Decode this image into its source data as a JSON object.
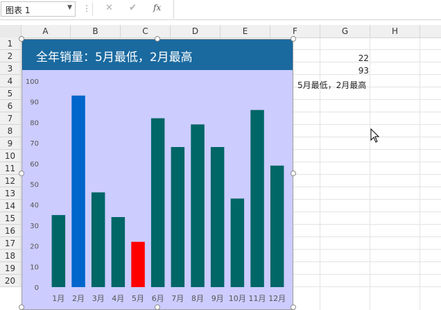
{
  "namebox": {
    "value": "图表 1"
  },
  "formula_bar": {
    "fx_label": "fx",
    "value": ""
  },
  "columns": [
    "A",
    "B",
    "C",
    "D",
    "E",
    "F",
    "G",
    "H"
  ],
  "rows": [
    "1",
    "2",
    "3",
    "4",
    "5",
    "6",
    "7",
    "8",
    "9",
    "10",
    "11",
    "12",
    "13",
    "14",
    "15",
    "16",
    "17",
    "18",
    "19",
    "20"
  ],
  "cells": {
    "G2": "22",
    "G3": "93",
    "F4": "：5月最低，2月最高"
  },
  "chart": {
    "title": "全年销量：5月最低，2月最高",
    "colors": {
      "title_bg": "#1a6aa0",
      "plot_bg": "#ccccff",
      "bar_default": "#006666",
      "bar_max": "#0066cc",
      "bar_min": "#ff0000"
    }
  },
  "chart_data": {
    "type": "bar",
    "title": "全年销量：5月最低，2月最高",
    "categories": [
      "1月",
      "2月",
      "3月",
      "4月",
      "5月",
      "6月",
      "7月",
      "8月",
      "9月",
      "10月",
      "11月",
      "12月"
    ],
    "values": [
      35,
      93,
      46,
      34,
      22,
      82,
      68,
      79,
      68,
      43,
      86,
      59
    ],
    "ylim": [
      0,
      100
    ],
    "yticks": [
      0,
      10,
      20,
      30,
      40,
      50,
      60,
      70,
      80,
      90,
      100
    ],
    "highlight": {
      "max_index": 1,
      "min_index": 4
    },
    "legend": "none",
    "grid": false
  }
}
